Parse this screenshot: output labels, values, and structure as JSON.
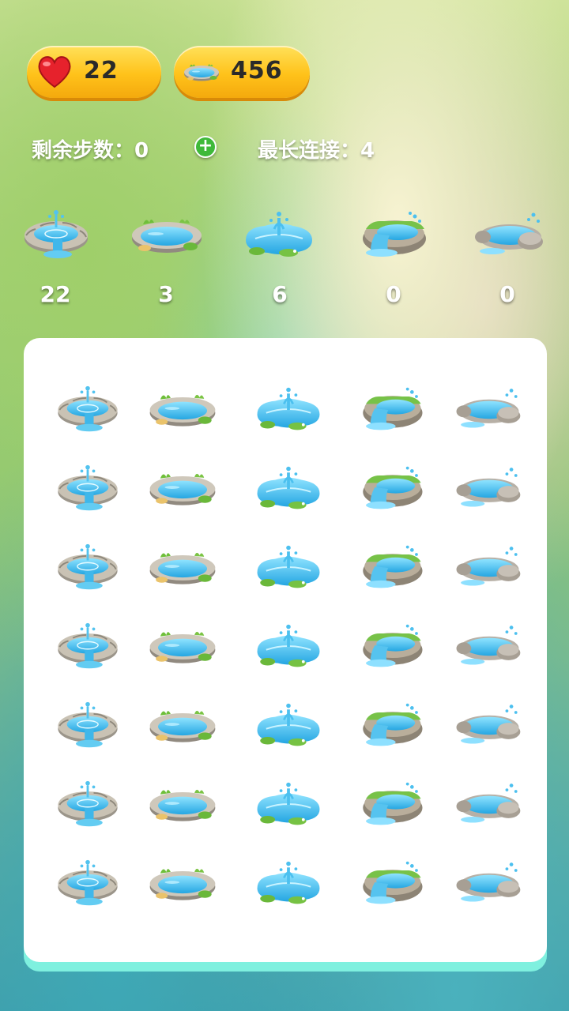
{
  "hud": {
    "hearts": "22",
    "coins": "456"
  },
  "stats": {
    "steps_label": "剩余步数：",
    "steps_value": "0",
    "plus": "+",
    "longest_label": "最长连接：",
    "longest_value": "4"
  },
  "targets": [
    {
      "icon": "stone-fountain-icon",
      "count": "22"
    },
    {
      "icon": "grassy-pond-icon",
      "count": "3"
    },
    {
      "icon": "splash-puddle-icon",
      "count": "6"
    },
    {
      "icon": "waterfall-pond-icon",
      "count": "0"
    },
    {
      "icon": "rock-pool-icon",
      "count": "0"
    }
  ],
  "board": {
    "rows": 7,
    "columns": [
      "stone-fountain-icon",
      "grassy-pond-icon",
      "splash-puddle-icon",
      "waterfall-pond-icon",
      "rock-pool-icon"
    ]
  },
  "colors": {
    "pill": "#ffc21a",
    "water": "#3fb7ea",
    "board_shadow": "#7ff0df",
    "plus": "#3fb93a"
  }
}
